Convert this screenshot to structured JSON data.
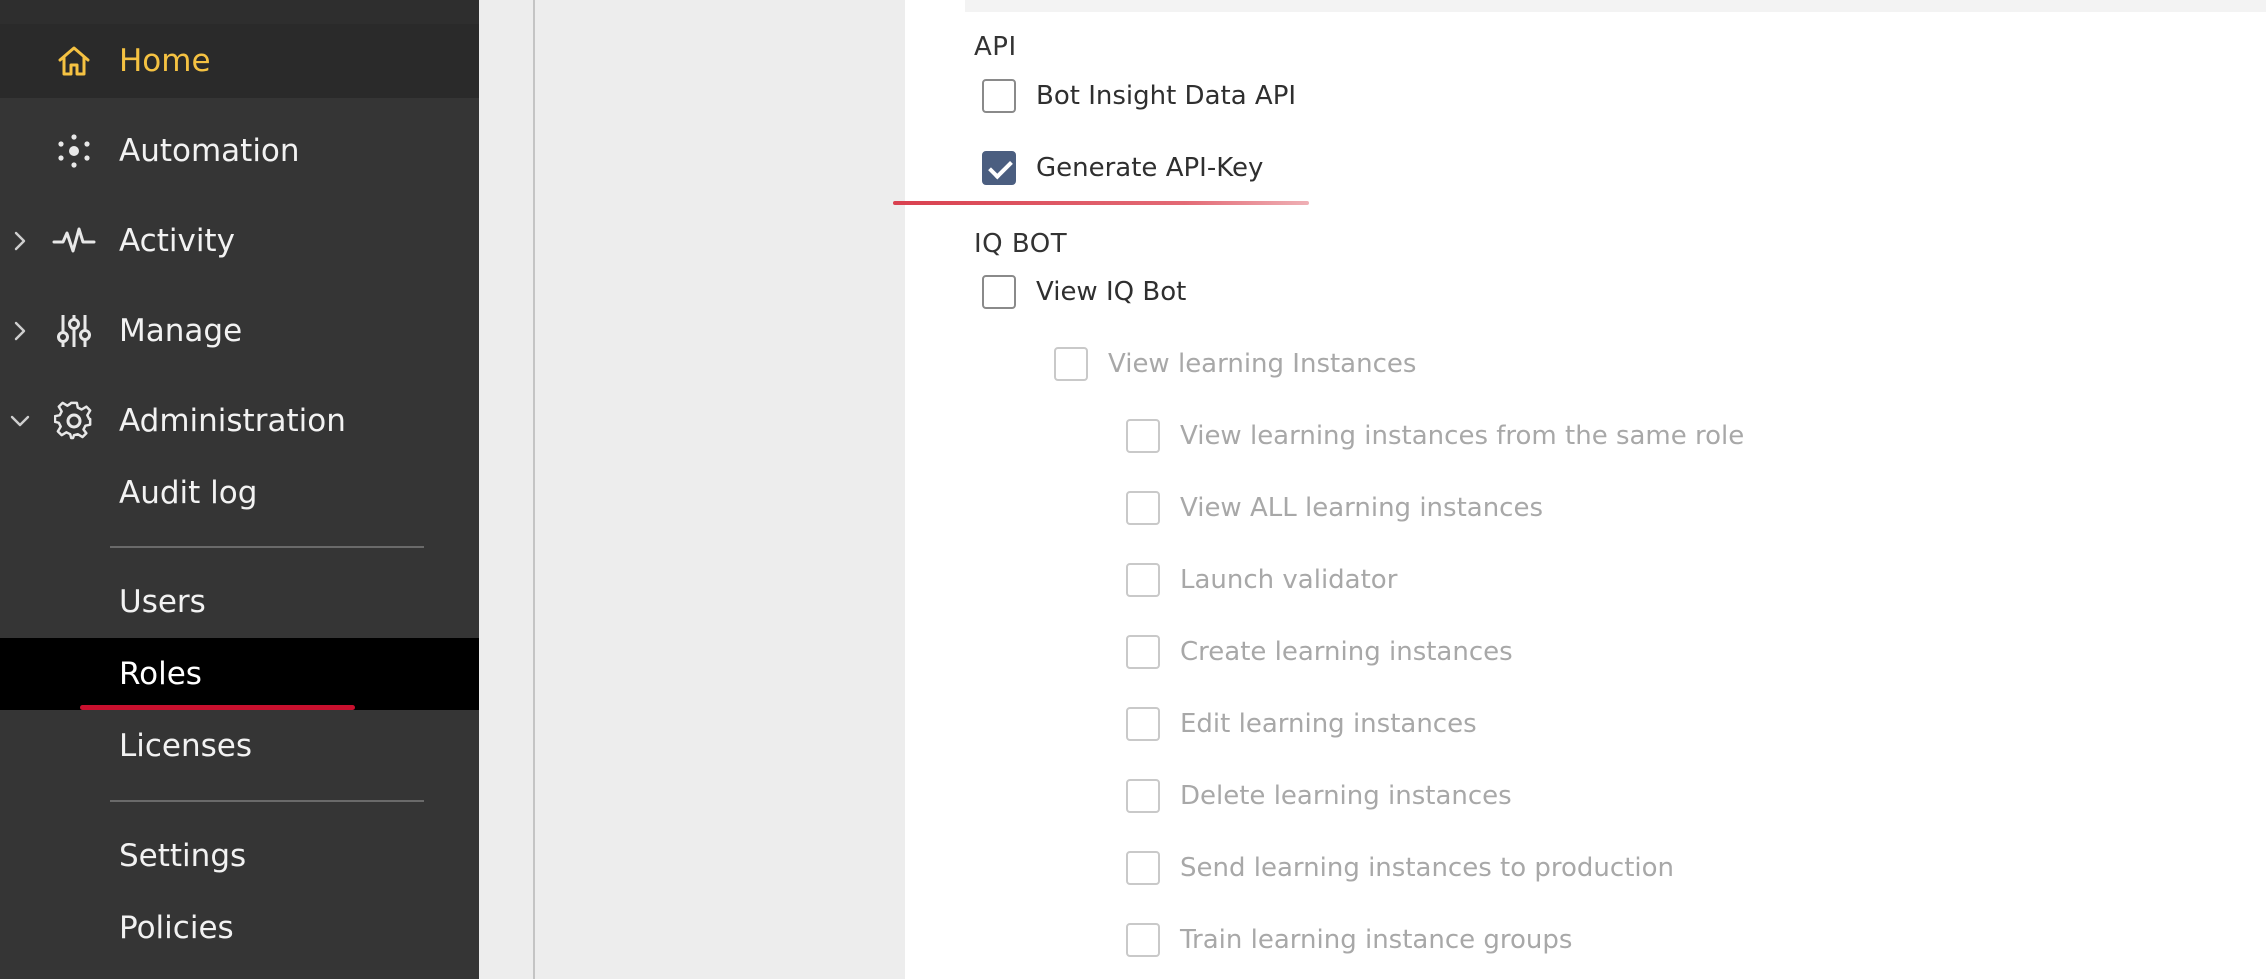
{
  "sidebar": {
    "nav": [
      {
        "label": "Home",
        "icon": "home-icon",
        "active": true
      },
      {
        "label": "Automation",
        "icon": "automation-icon"
      },
      {
        "label": "Activity",
        "icon": "activity-pulse-icon",
        "chevron": "right"
      },
      {
        "label": "Manage",
        "icon": "sliders-icon",
        "chevron": "right"
      },
      {
        "label": "Administration",
        "icon": "gear-icon",
        "chevron": "down"
      }
    ],
    "sub_items": [
      {
        "label": "Audit log"
      },
      {
        "label": "Users"
      },
      {
        "label": "Roles",
        "selected": true
      },
      {
        "label": "Licenses"
      },
      {
        "label": "Settings"
      },
      {
        "label": "Policies"
      }
    ],
    "colors": {
      "background": "#353535",
      "active_text": "#f5c242",
      "selected_bg": "#000000"
    }
  },
  "permissions": {
    "api": {
      "title": "API",
      "items": [
        {
          "label": "Bot Insight Data API",
          "checked": false
        },
        {
          "label": "Generate API-Key",
          "checked": true
        }
      ]
    },
    "iq_bot": {
      "title": "IQ BOT",
      "items": [
        {
          "label": "View IQ Bot",
          "checked": false
        },
        {
          "label": "View learning Instances",
          "checked": false,
          "disabled": true
        },
        {
          "label": "View learning instances from the same role",
          "checked": false,
          "disabled": true
        },
        {
          "label": "View ALL learning instances",
          "checked": false,
          "disabled": true
        },
        {
          "label": "Launch validator",
          "checked": false,
          "disabled": true
        },
        {
          "label": "Create learning instances",
          "checked": false,
          "disabled": true
        },
        {
          "label": "Edit learning instances",
          "checked": false,
          "disabled": true
        },
        {
          "label": "Delete learning instances",
          "checked": false,
          "disabled": true
        },
        {
          "label": "Send learning instances to production",
          "checked": false,
          "disabled": true
        },
        {
          "label": "Train learning instance groups",
          "checked": false,
          "disabled": true
        }
      ]
    },
    "colors": {
      "checked": "#4b5e80",
      "annotation_underline": "#d9404f"
    }
  }
}
